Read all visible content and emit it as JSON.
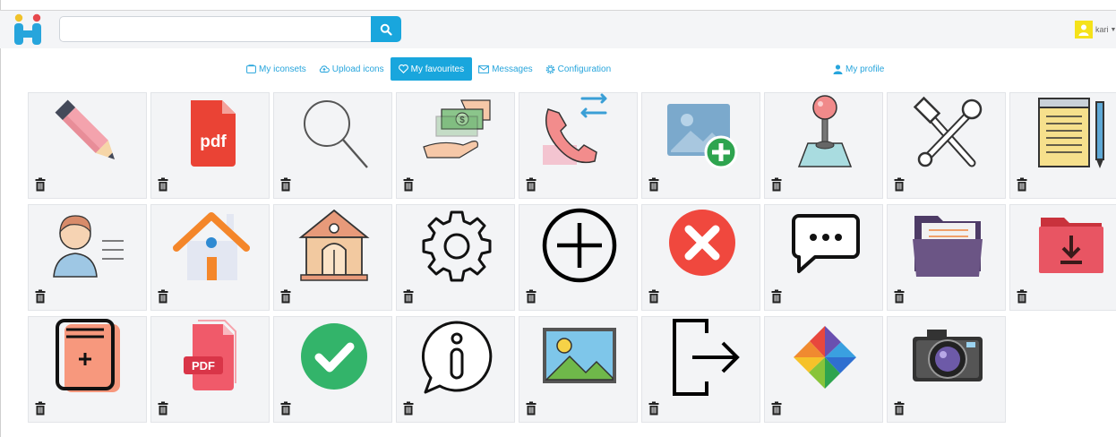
{
  "app": {
    "logo": "iconhub-logo"
  },
  "search": {
    "value": "",
    "placeholder": "",
    "button_icon": "search-icon"
  },
  "user": {
    "name": "kari",
    "avatar_color": "#f5e21a"
  },
  "nav": {
    "items": [
      {
        "label": "My iconsets",
        "icon": "iconset-icon",
        "active": false
      },
      {
        "label": "Upload icons",
        "icon": "cloud-upload-icon",
        "active": false
      },
      {
        "label": "My favourites",
        "icon": "heart-icon",
        "active": true
      },
      {
        "label": "Messages",
        "icon": "envelope-icon",
        "active": false
      },
      {
        "label": "Configuration",
        "icon": "cog-icon",
        "active": false
      }
    ],
    "profile_label": "My profile"
  },
  "colors": {
    "accent": "#19a6dd",
    "tile_bg": "#f3f4f6"
  },
  "favourites": [
    "pencil-icon",
    "pdf-file-icon",
    "magnifier-icon",
    "money-payment-icon",
    "call-transfer-icon",
    "add-image-icon",
    "joystick-icon",
    "tools-icon",
    "notepad-icon",
    "user-profile-icon",
    "home-icon",
    "house-building-icon",
    "gear-icon",
    "plus-circle-icon",
    "close-circle-icon",
    "chat-bubble-icon",
    "folder-icon",
    "download-folder-icon",
    "add-document-icon",
    "pdf-document-icon",
    "check-circle-icon",
    "info-bubble-icon",
    "landscape-image-icon",
    "logout-icon",
    "pinwheel-icon",
    "camera-icon"
  ]
}
